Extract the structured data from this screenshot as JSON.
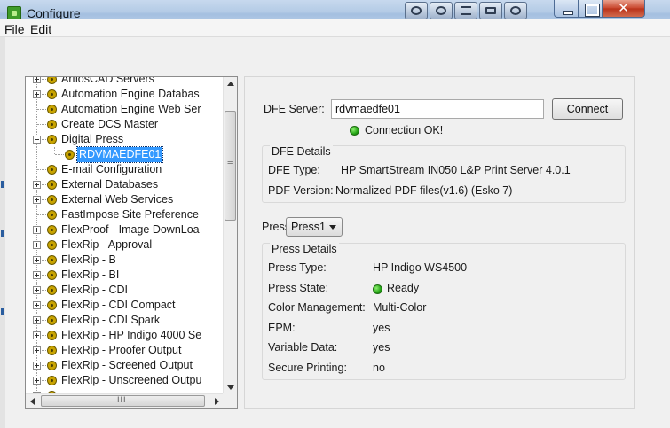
{
  "window": {
    "title": "Configure",
    "close_glyph": "✕"
  },
  "menu": {
    "file": "File",
    "edit": "Edit"
  },
  "tree": {
    "items": [
      {
        "label": "ArtiosCAD Servers",
        "expander": "plus",
        "level": 1
      },
      {
        "label": "Automation Engine Databas",
        "expander": "plus",
        "level": 1
      },
      {
        "label": "Automation Engine Web Ser",
        "expander": "none",
        "level": 1
      },
      {
        "label": "Create DCS Master",
        "expander": "none",
        "level": 1
      },
      {
        "label": "Digital Press",
        "expander": "minus",
        "level": 1
      },
      {
        "label": "RDVMAEDFE01",
        "expander": "none",
        "level": 2,
        "selected": true
      },
      {
        "label": "E-mail Configuration",
        "expander": "none",
        "level": 1
      },
      {
        "label": "External Databases",
        "expander": "plus",
        "level": 1
      },
      {
        "label": "External Web Services",
        "expander": "plus",
        "level": 1
      },
      {
        "label": "FastImpose Site Preference",
        "expander": "none",
        "level": 1
      },
      {
        "label": "FlexProof - Image DownLoa",
        "expander": "plus",
        "level": 1
      },
      {
        "label": "FlexRip - Approval",
        "expander": "plus",
        "level": 1
      },
      {
        "label": "FlexRip - B",
        "expander": "plus",
        "level": 1
      },
      {
        "label": "FlexRip - BI",
        "expander": "plus",
        "level": 1
      },
      {
        "label": "FlexRip - CDI",
        "expander": "plus",
        "level": 1
      },
      {
        "label": "FlexRip - CDI Compact",
        "expander": "plus",
        "level": 1
      },
      {
        "label": "FlexRip - CDI Spark",
        "expander": "plus",
        "level": 1
      },
      {
        "label": "FlexRip - HP Indigo 4000 Se",
        "expander": "plus",
        "level": 1
      },
      {
        "label": "FlexRip - Proofer Output",
        "expander": "plus",
        "level": 1
      },
      {
        "label": "FlexRip - Screened Output",
        "expander": "plus",
        "level": 1
      },
      {
        "label": "FlexRip - Unscreened Outpu",
        "expander": "plus",
        "level": 1
      },
      {
        "label": "",
        "expander": "plus",
        "level": 1
      }
    ],
    "hscroll_grip": "III"
  },
  "dfe": {
    "server_label": "DFE Server:",
    "server_value": "rdvmaedfe01",
    "connect_label": "Connect",
    "connection_status": "Connection OK!",
    "details_title": "DFE Details",
    "type_label": "DFE Type:",
    "type_value": "HP SmartStream IN050 L&P Print Server 4.0.1",
    "pdf_label": "PDF Version:",
    "pdf_value": "Normalized PDF files(v1.6) (Esko 7)"
  },
  "press": {
    "label": "Press:",
    "selected": "Press1",
    "details_title": "Press Details",
    "rows": [
      {
        "label": "Press Type:",
        "value": "HP Indigo WS4500"
      },
      {
        "label": "Press State:",
        "value": "Ready",
        "status_dot": true
      },
      {
        "label": "Color Management:",
        "value": "Multi-Color"
      },
      {
        "label": "EPM:",
        "value": "yes"
      },
      {
        "label": "Variable Data:",
        "value": "yes"
      },
      {
        "label": "Secure Printing:",
        "value": "no"
      }
    ]
  },
  "colors": {
    "selection": "#3399ff",
    "status_green": "#23a313",
    "title_bar": "#b4cbe6"
  }
}
